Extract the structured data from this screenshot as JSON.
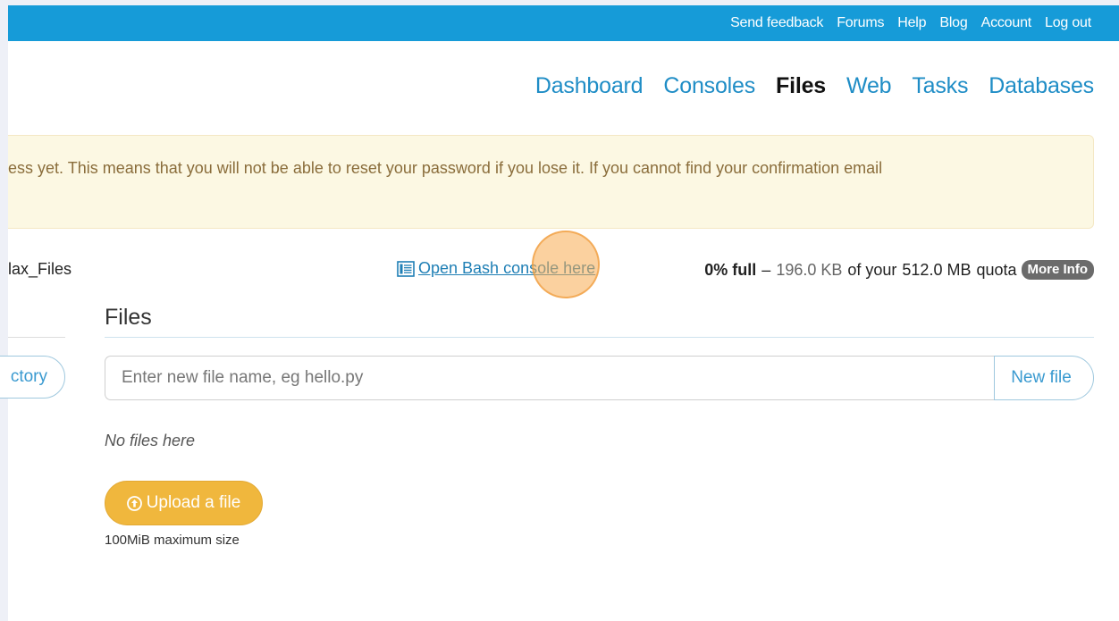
{
  "topbar": {
    "links": [
      "Send feedback",
      "Forums",
      "Help",
      "Blog",
      "Account",
      "Log out"
    ]
  },
  "nav": {
    "items": [
      "Dashboard",
      "Consoles",
      "Files",
      "Web",
      "Tasks",
      "Databases"
    ],
    "active": "Files"
  },
  "warning": {
    "text": "ess yet. This means that you will not be able to reset your password if you lose it. If you cannot find your confirmation email"
  },
  "path": {
    "label": "lax_Files"
  },
  "bash": {
    "label": "Open Bash console here",
    "icon": "console-icon"
  },
  "quota": {
    "percent": "0% full",
    "dash": "–",
    "used": "196.0 KB",
    "of_your": "of your",
    "total": "512.0 MB",
    "quota_word": "quota",
    "more_info": "More Info"
  },
  "left": {
    "directory_button": "ctory"
  },
  "files": {
    "title": "Files",
    "input_placeholder": "Enter new file name, eg hello.py",
    "new_file_button": "New file",
    "empty_text": "No files here",
    "upload_button": "Upload a file",
    "upload_icon": "upload-circle-icon",
    "max_size": "100MiB maximum size"
  },
  "colors": {
    "topbar": "#169bd8",
    "link": "#1f8dc6",
    "warning_bg": "#fcf8e3",
    "warning_text": "#8a6d3b",
    "upload": "#f0b73d",
    "badge": "#6b6b6b"
  }
}
